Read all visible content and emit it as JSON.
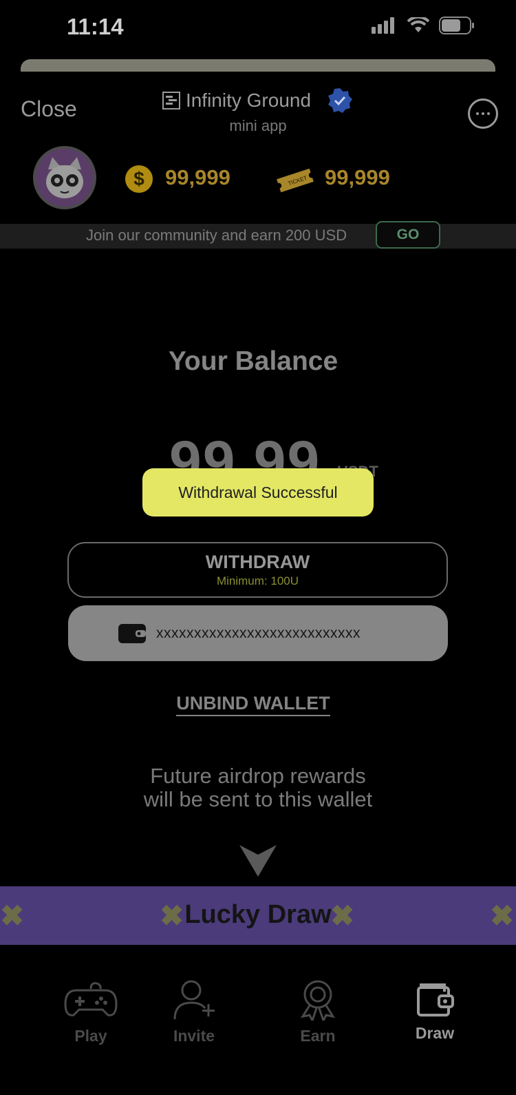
{
  "status": {
    "time": "11:14"
  },
  "header": {
    "close_label": "Close",
    "app_name": "Infinity Ground",
    "app_sub": "mini app"
  },
  "stats": {
    "coins": "99,999",
    "tickets": "99,999"
  },
  "banner": {
    "text": "Join our community and earn 200 USD",
    "go_label": "GO"
  },
  "balance": {
    "title": "Your Balance",
    "value": "99.99",
    "unit": "USDT"
  },
  "toast": {
    "text": "Withdrawal Successful"
  },
  "withdraw": {
    "label": "WITHDRAW",
    "minimum": "Minimum: 100U"
  },
  "wallet": {
    "address": "xxxxxxxxxxxxxxxxxxxxxxxxxxx"
  },
  "unbind_label": "UNBIND WALLET",
  "future": {
    "line1": "Future airdrop rewards",
    "line2": "will be sent to this wallet"
  },
  "lucky_draw": {
    "label": "Lucky Draw"
  },
  "tabs": [
    {
      "label": "Play",
      "icon": "gamepad-icon"
    },
    {
      "label": "Invite",
      "icon": "add-user-icon"
    },
    {
      "label": "Earn",
      "icon": "award-icon"
    },
    {
      "label": "Draw",
      "icon": "wallet-icon",
      "active": true
    }
  ],
  "colors": {
    "toast_bg": "#e3e764",
    "lucky_bg": "#4b3b7b",
    "accent_gold": "#a8862a"
  }
}
